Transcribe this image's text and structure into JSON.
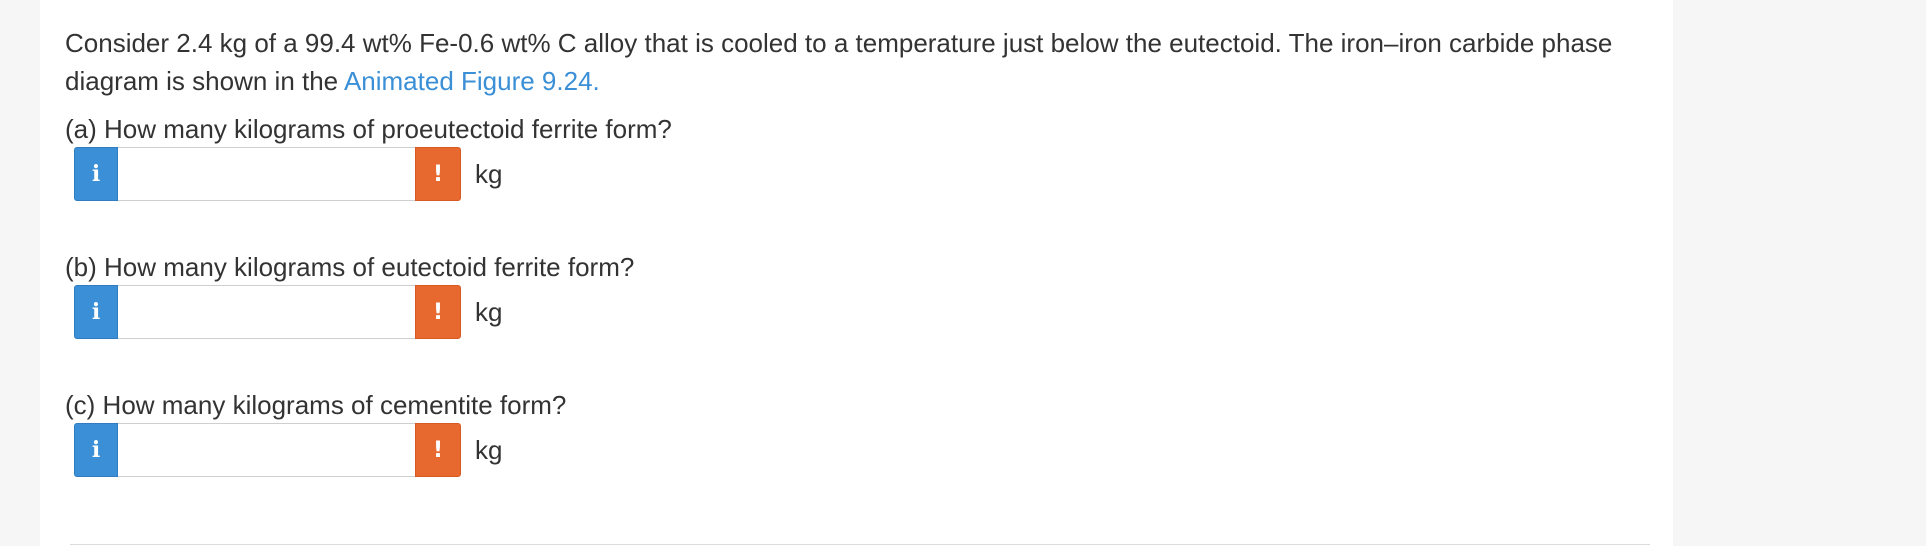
{
  "problem": {
    "intro_text": "Consider 2.4 kg of a 99.4 wt% Fe-0.6 wt% C alloy that is cooled to a temperature just below the eutectoid. The iron–iron carbide phase diagram is shown in the ",
    "figure_link": "Animated Figure 9.24.",
    "questions": [
      {
        "label": "(a) How many kilograms of proeutectoid ferrite form?",
        "value": "",
        "unit": "kg",
        "info_icon": "i",
        "warning_icon": "!"
      },
      {
        "label": "(b) How many kilograms of eutectoid ferrite form?",
        "value": "",
        "unit": "kg",
        "info_icon": "i",
        "warning_icon": "!"
      },
      {
        "label": "(c) How many kilograms of cementite form?",
        "value": "",
        "unit": "kg",
        "info_icon": "i",
        "warning_icon": "!"
      }
    ]
  },
  "colors": {
    "link": "#3a8fd6",
    "info_button": "#3a8fd6",
    "warning_button": "#e8692f",
    "text": "#333333"
  }
}
